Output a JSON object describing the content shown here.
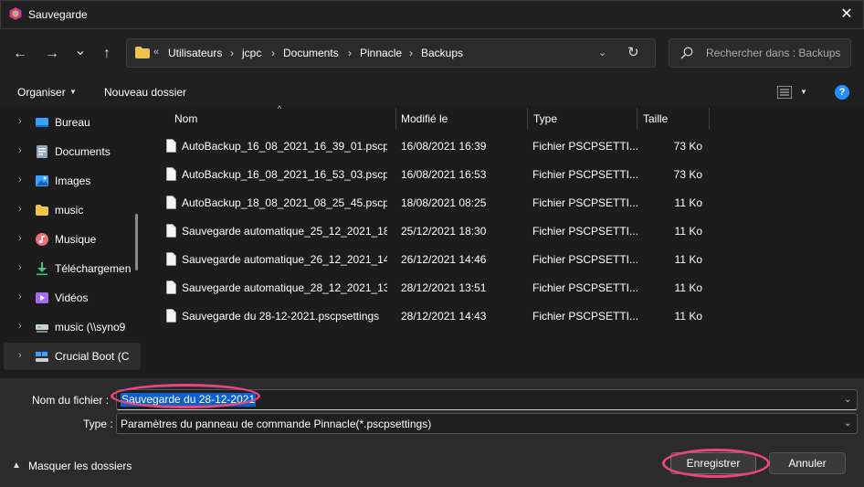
{
  "window": {
    "title": "Sauvegarde",
    "close": "✕"
  },
  "nav": {
    "back": "←",
    "forward": "→",
    "recent": "⌄",
    "up": "↑"
  },
  "address": {
    "overflow": "«",
    "crumbs": [
      "Utilisateurs",
      "jcpc",
      "Documents",
      "Pinnacle",
      "Backups"
    ],
    "separator": "›"
  },
  "search": {
    "placeholder": "Rechercher dans : Backups"
  },
  "toolbar": {
    "organise_label": "Organiser",
    "new_folder_label": "Nouveau dossier",
    "help": "?"
  },
  "sidebar": {
    "items": [
      {
        "label": "Bureau",
        "icon": "desktop-icon"
      },
      {
        "label": "Documents",
        "icon": "documents-icon"
      },
      {
        "label": "Images",
        "icon": "images-icon"
      },
      {
        "label": "music",
        "icon": "folder-icon"
      },
      {
        "label": "Musique",
        "icon": "music-icon"
      },
      {
        "label": "Téléchargemen",
        "icon": "download-icon"
      },
      {
        "label": "Vidéos",
        "icon": "video-icon"
      },
      {
        "label": "music (\\\\syno9",
        "icon": "network-drive-icon"
      },
      {
        "label": "Crucial Boot (C",
        "icon": "drive-icon"
      }
    ]
  },
  "columns": {
    "name": "Nom",
    "modified": "Modifié le",
    "type": "Type",
    "size": "Taille"
  },
  "files": [
    {
      "name": "AutoBackup_16_08_2021_16_39_01.pscps...",
      "modified": "16/08/2021 16:39",
      "type": "Fichier PSCPSETTI...",
      "size": "73 Ko"
    },
    {
      "name": "AutoBackup_16_08_2021_16_53_03.pscps...",
      "modified": "16/08/2021 16:53",
      "type": "Fichier PSCPSETTI...",
      "size": "73 Ko"
    },
    {
      "name": "AutoBackup_18_08_2021_08_25_45.pscps...",
      "modified": "18/08/2021 08:25",
      "type": "Fichier PSCPSETTI...",
      "size": "11 Ko"
    },
    {
      "name": "Sauvegarde automatique_25_12_2021_18_...",
      "modified": "25/12/2021 18:30",
      "type": "Fichier PSCPSETTI...",
      "size": "11 Ko"
    },
    {
      "name": "Sauvegarde automatique_26_12_2021_14_...",
      "modified": "26/12/2021 14:46",
      "type": "Fichier PSCPSETTI...",
      "size": "11 Ko"
    },
    {
      "name": "Sauvegarde automatique_28_12_2021_13_...",
      "modified": "28/12/2021 13:51",
      "type": "Fichier PSCPSETTI...",
      "size": "11 Ko"
    },
    {
      "name": "Sauvegarde du 28-12-2021.pscpsettings",
      "modified": "28/12/2021 14:43",
      "type": "Fichier PSCPSETTI...",
      "size": "11 Ko"
    }
  ],
  "form": {
    "filename_label": "Nom du fichier :",
    "filename_value": "Sauvegarde du 28-12-2021",
    "type_label": "Type :",
    "type_value": "Paramètres du panneau de commande Pinnacle(*.pscpsettings)"
  },
  "footer": {
    "hide_folders_label": "Masquer les dossiers",
    "save_label": "Enregistrer",
    "cancel_label": "Annuler"
  },
  "colors": {
    "accent": "#0b60c9",
    "highlight": "#e8467f",
    "help_badge": "#1e90ff"
  }
}
